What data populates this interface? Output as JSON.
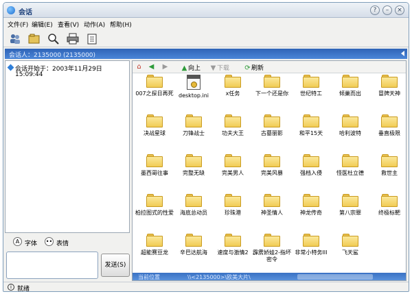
{
  "window": {
    "title": "会话"
  },
  "menu": [
    "文件(F)",
    "编辑(E)",
    "查看(V)",
    "动作(A)",
    "帮助(H)"
  ],
  "toolbar": [
    {
      "name": "users-icon"
    },
    {
      "name": "folder-open-icon"
    },
    {
      "name": "search-icon"
    },
    {
      "name": "printer-icon"
    },
    {
      "name": "clipboard-icon"
    }
  ],
  "session": {
    "label": "会话人：2135000 (2135000)"
  },
  "log": {
    "line1": "会话开始于：2003年11月29日",
    "line2": "15:09:44"
  },
  "format": {
    "font_label": "字体",
    "emoji_label": "表情"
  },
  "send": {
    "label": "发送(S)"
  },
  "nav": {
    "up_label": "向上",
    "download_label": "下载",
    "refresh_label": "刷新"
  },
  "files": [
    {
      "label": "007之探日再死",
      "type": "folder"
    },
    {
      "label": "desktop.ini",
      "type": "file"
    },
    {
      "label": "x任务",
      "type": "folder"
    },
    {
      "label": "下一个还是你",
      "type": "folder"
    },
    {
      "label": "世纪特工",
      "type": "folder"
    },
    {
      "label": "倾巢而出",
      "type": "folder"
    },
    {
      "label": "冒牌天神",
      "type": "folder"
    },
    {
      "label": "决战星球",
      "type": "folder"
    },
    {
      "label": "刀锋战士",
      "type": "folder"
    },
    {
      "label": "功夫大王",
      "type": "folder"
    },
    {
      "label": "古墓丽影",
      "type": "folder"
    },
    {
      "label": "和平15天",
      "type": "folder"
    },
    {
      "label": "哈利波特",
      "type": "folder"
    },
    {
      "label": "垂直极限",
      "type": "folder"
    },
    {
      "label": "墨西哥往事",
      "type": "folder"
    },
    {
      "label": "完整无缺",
      "type": "folder"
    },
    {
      "label": "完美男人",
      "type": "folder"
    },
    {
      "label": "完美风暴",
      "type": "folder"
    },
    {
      "label": "强档入侵",
      "type": "folder"
    },
    {
      "label": "怪医杜立德",
      "type": "folder"
    },
    {
      "label": "救世主",
      "type": "folder"
    },
    {
      "label": "柏拉图式的性爱",
      "type": "folder"
    },
    {
      "label": "海底总动员",
      "type": "folder"
    },
    {
      "label": "珍珠港",
      "type": "folder"
    },
    {
      "label": "神圣情人",
      "type": "folder"
    },
    {
      "label": "神龙传奇",
      "type": "folder"
    },
    {
      "label": "第八宗罪",
      "type": "folder"
    },
    {
      "label": "终极标靶",
      "type": "folder"
    },
    {
      "label": "超能赛豆龙",
      "type": "folder"
    },
    {
      "label": "辛巴达航海",
      "type": "folder"
    },
    {
      "label": "速度与激情2",
      "type": "folder"
    },
    {
      "label": "霹雳娇娃2-指坏密令",
      "type": "folder"
    },
    {
      "label": "非常小特务III",
      "type": "folder"
    },
    {
      "label": "飞天鲨",
      "type": "folder"
    }
  ],
  "path": {
    "label": "当前位置",
    "value": "\\\\<2135000>\\欧美大片\\"
  },
  "status": {
    "text": "就绪"
  },
  "colors": {
    "title_bar": "#d6dee9",
    "session_bar": "#3a72c4",
    "folder": "#f1cc55"
  }
}
